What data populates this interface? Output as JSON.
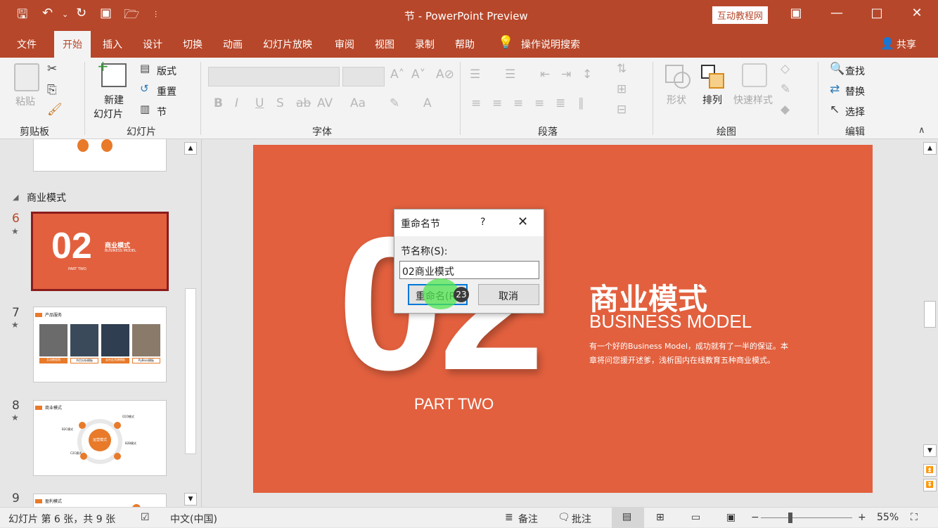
{
  "titlebar": {
    "title": "节  -  PowerPoint Preview",
    "brand": "互动教程网",
    "accent": "#b7472a"
  },
  "tabs": [
    "文件",
    "开始",
    "插入",
    "设计",
    "切换",
    "动画",
    "幻灯片放映",
    "审阅",
    "视图",
    "录制",
    "帮助"
  ],
  "tell_me": "操作说明搜索",
  "share": "共享",
  "ribbon": {
    "clipboard": {
      "paste": "粘贴",
      "label": "剪贴板"
    },
    "slides": {
      "new_line1": "新建",
      "new_line2": "幻灯片",
      "layout": "版式",
      "reset": "重置",
      "section": "节",
      "label": "幻灯片"
    },
    "font": {
      "label": "字体"
    },
    "paragraph": {
      "label": "段落"
    },
    "drawing": {
      "shape": "形状",
      "arrange": "排列",
      "quick_style": "快速样式",
      "label": "绘图"
    },
    "editing": {
      "find": "查找",
      "replace": "替换",
      "select": "选择",
      "label": "编辑"
    }
  },
  "left_panel": {
    "section_name": "商业模式",
    "slides": [
      {
        "num": "6",
        "title": "商业模式",
        "sub": "BUSINESS MODEL",
        "big": "02",
        "part": "PART TWO"
      },
      {
        "num": "7",
        "title": "产品服务",
        "cards": [
          "互动教程网",
          "节目分析模板",
          "云社区资源模板",
          "PyBoss模板"
        ]
      },
      {
        "num": "8",
        "title": "商业模式",
        "center": "运营模式",
        "nodes": [
          "B2C模式",
          "O2O模式",
          "C2C模式",
          "B2B模式"
        ]
      },
      {
        "num": "9",
        "title": "盈利模式"
      }
    ]
  },
  "slide": {
    "big": "02",
    "part": "PART TWO",
    "title": "商业模式",
    "subtitle": "BUSINESS MODEL",
    "desc_line1": "有一个好的Business Model，成功就有了一半的保证。本",
    "desc_line2": "章将问您援开述爹，浅析国内在线教育五种商业模式。",
    "bg": "#e2603e"
  },
  "dialog": {
    "title": "重命名节",
    "help": "?",
    "field_label": "节名称(S):",
    "field_value": "02商业模式",
    "ok": "重命名(R)",
    "cancel": "取消",
    "badge": "23"
  },
  "status": {
    "slide_info": "幻灯片 第 6 张，共 9 张",
    "language": "中文(中国)",
    "notes": "备注",
    "comments": "批注",
    "zoom": "55%"
  }
}
